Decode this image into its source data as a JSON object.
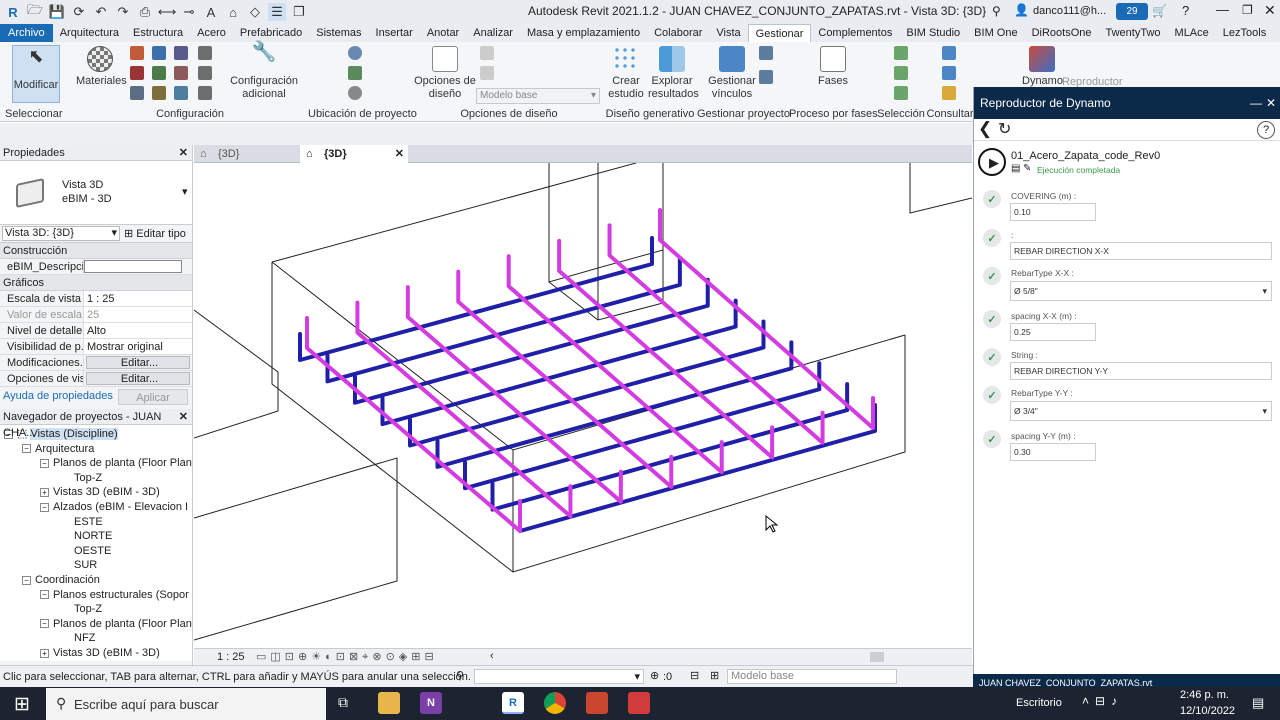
{
  "app": {
    "title": "Autodesk Revit 2021.1.2 - JUAN CHAVEZ_CONJUNTO_ZAPATAS.rvt - Vista 3D: {3D}",
    "user": "danco111@h...",
    "notification_count": "29"
  },
  "menu": [
    "Archivo",
    "Arquitectura",
    "Estructura",
    "Acero",
    "Prefabricado",
    "Sistemas",
    "Insertar",
    "Anotar",
    "Analizar",
    "Masa y emplazamiento",
    "Colaborar",
    "Vista",
    "Gestionar",
    "Complementos",
    "BIM Studio",
    "BIM One",
    "DiRootsOne",
    "TwentyTwo",
    "MLAce",
    "LezTools"
  ],
  "ribbon": {
    "modify": "Modificar",
    "materials": "Materiales",
    "config_adicional": "Configuración adicional",
    "design_options": "Opciones de diseño",
    "main_model": "Modelo base",
    "create_study": "Crear estudio",
    "explore_results": "Explorar resultados",
    "manage_links": "Gestionar vínculos",
    "phases": "Fases",
    "dynamo": "Dynamo",
    "player": "Reproductor",
    "groups": [
      "Seleccionar",
      "Configuración",
      "Ubicación de proyecto",
      "Opciones de diseño",
      "Diseño generativo",
      "Gestionar proyecto",
      "Proceso por fases",
      "Selección",
      "Consultar"
    ]
  },
  "properties": {
    "header": "Propiedades",
    "type_name": "Vista 3D",
    "type_sub": "eBIM - 3D",
    "selector": "Vista 3D: {3D}",
    "edit_type": "Editar tipo",
    "sections": [
      "Construcción",
      "Gráficos"
    ],
    "rows": [
      {
        "key": "eBIM_Descripci...",
        "value": ""
      },
      {
        "key": "Escala de vista",
        "value": "1 : 25"
      },
      {
        "key": "Valor de escala...",
        "value": "25"
      },
      {
        "key": "Nivel de detalle",
        "value": "Alto"
      },
      {
        "key": "Visibilidad de p...",
        "value": "Mostrar original"
      },
      {
        "key": "Modificaciones...",
        "value": "Editar..."
      },
      {
        "key": "Opciones de vis...",
        "value": "Editar..."
      }
    ],
    "help": "Ayuda de propiedades",
    "apply": "Aplicar"
  },
  "browser": {
    "header": "Navegador de proyectos - JUAN CHA...",
    "items": [
      "Vistas (Discipline)",
      "Arquitectura",
      "Planos de planta (Floor Plan",
      "Top-Z",
      "Vistas 3D (eBIM - 3D)",
      "Alzados (eBIM - Elevacion I",
      "ESTE",
      "NORTE",
      "OESTE",
      "SUR",
      "Coordinación",
      "Planos estructurales (Sopor",
      "Top-Z",
      "Planos de planta (Floor Plan",
      "NFZ",
      "Vistas 3D (eBIM - 3D)"
    ]
  },
  "view_tabs": [
    "{3D}",
    "{3D}"
  ],
  "view_scale": "1 : 25",
  "status": {
    "hint": "Clic para seleccionar, TAB para alternar, CTRL para añadir y MAYÚS para anular una selección.",
    "zero": ":0",
    "model": "Modelo base"
  },
  "dynamo": {
    "title": "Reproductor de Dynamo",
    "script": "01_Acero_Zapata_code_Rev0",
    "status": "Ejecución completada",
    "file": "JUAN CHAVEZ_CONJUNTO_ZAPATAS.rvt",
    "inputs": [
      {
        "label": "COVERING (m) :",
        "value": "0.10"
      },
      {
        "label": ":",
        "value": "REBAR DIRECTION X-X"
      },
      {
        "label": "RebarType X-X :",
        "value": "Ø 5/8\""
      },
      {
        "label": "spacing X-X (m) :",
        "value": "0.25"
      },
      {
        "label": "String :",
        "value": "REBAR DIRECTION Y-Y"
      },
      {
        "label": "RebarType Y-Y :",
        "value": "Ø 3/4\""
      },
      {
        "label": "spacing Y-Y (m) :",
        "value": "0.30"
      }
    ]
  },
  "taskbar": {
    "search": "Escribe aquí para buscar",
    "desktop": "Escritorio",
    "time": "2:46 p. m.",
    "date": "12/10/2022"
  },
  "colors": {
    "rebar_x": "#1f1fa8",
    "rebar_y": "#d23ce0",
    "titlebar_dark": "#0b2a4a",
    "file_tab": "#1a6bb5"
  }
}
